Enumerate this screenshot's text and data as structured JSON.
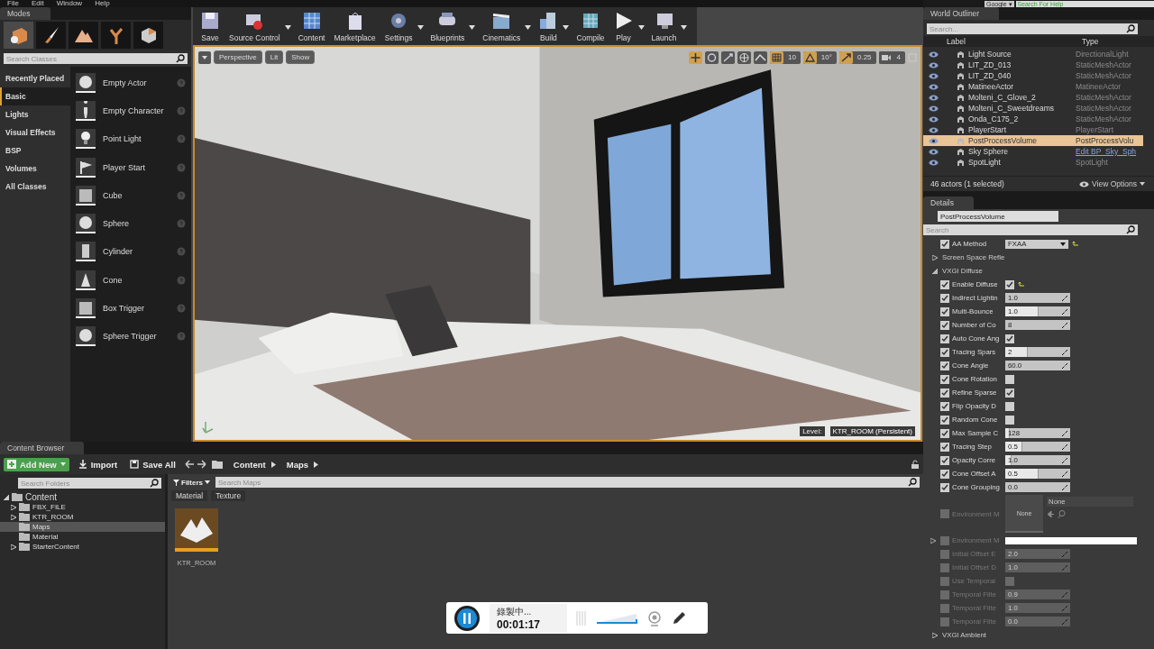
{
  "menu": [
    "File",
    "Edit",
    "Window",
    "Help"
  ],
  "help_search": {
    "scope": "Google ▾",
    "placeholder": "Search For Help"
  },
  "modes": {
    "tab": "Modes",
    "tools": [
      {
        "kind": "box",
        "selected": true
      },
      {
        "kind": "brush",
        "selected": false
      },
      {
        "kind": "mountain",
        "selected": false
      },
      {
        "kind": "leaf",
        "selected": false
      },
      {
        "kind": "cube",
        "selected": false
      }
    ],
    "search": {
      "placeholder": "Search Classes"
    },
    "categories": [
      {
        "label": "Recently Placed",
        "selected": false
      },
      {
        "label": "Basic",
        "selected": true
      },
      {
        "label": "Lights",
        "selected": false
      },
      {
        "label": "Visual Effects",
        "selected": false
      },
      {
        "label": "BSP",
        "selected": false
      },
      {
        "label": "Volumes",
        "selected": false
      },
      {
        "label": "All Classes",
        "selected": false
      }
    ],
    "items": [
      {
        "label": "Empty Actor",
        "kind": "sphere"
      },
      {
        "label": "Empty Character",
        "kind": "figure"
      },
      {
        "label": "Point Light",
        "kind": "bulb"
      },
      {
        "label": "Player Start",
        "kind": "flag"
      },
      {
        "label": "Cube",
        "kind": "cube"
      },
      {
        "label": "Sphere",
        "kind": "sphere"
      },
      {
        "label": "Cylinder",
        "kind": "cylinder"
      },
      {
        "label": "Cone",
        "kind": "cone"
      },
      {
        "label": "Box Trigger",
        "kind": "cube"
      },
      {
        "label": "Sphere Trigger",
        "kind": "sphere"
      }
    ]
  },
  "toolbar": [
    {
      "label": "Save",
      "kind": "disk",
      "dropdown": false
    },
    {
      "label": "Source Control",
      "kind": "database",
      "dropdown": true
    },
    {
      "label": "Content",
      "kind": "grid",
      "dropdown": false
    },
    {
      "label": "Marketplace",
      "kind": "bag",
      "dropdown": false
    },
    {
      "label": "Settings",
      "kind": "gear",
      "dropdown": true
    },
    {
      "label": "Blueprints",
      "kind": "gamepad",
      "dropdown": true
    },
    {
      "label": "Cinematics",
      "kind": "clapper",
      "dropdown": true
    },
    {
      "label": "Build",
      "kind": "cubes",
      "dropdown": true
    },
    {
      "label": "Compile",
      "kind": "cube",
      "dropdown": false
    },
    {
      "label": "Play",
      "kind": "play",
      "dropdown": true
    },
    {
      "label": "Launch",
      "kind": "monitor",
      "dropdown": true
    }
  ],
  "viewport": {
    "buttons": [
      "Perspective",
      "Lit",
      "Show"
    ],
    "tools": [
      {
        "kind": "move",
        "selected": true
      },
      {
        "kind": "rotate",
        "selected": false
      },
      {
        "kind": "scale",
        "selected": false
      },
      {
        "kind": "globe",
        "selected": false
      },
      {
        "kind": "surface",
        "selected": false
      }
    ],
    "snaps": [
      {
        "kind": "grid",
        "on": true,
        "value": "10"
      },
      {
        "kind": "angle",
        "on": true,
        "value": "10°"
      },
      {
        "kind": "scale",
        "on": true,
        "value": "0.25"
      },
      {
        "kind": "speed",
        "on": false,
        "value": "4"
      }
    ],
    "level_label": "Level:",
    "level_name": "KTR_ROOM (Persistent)"
  },
  "outliner": {
    "tab": "World Outliner",
    "search": {
      "placeholder": "Search..."
    },
    "columns": [
      "Label",
      "Type"
    ],
    "rows": [
      {
        "label": "Light Source",
        "type": "DirectionalLight",
        "kind": "plain",
        "selected": false
      },
      {
        "label": "LIT_ZD_013",
        "type": "StaticMeshActor",
        "kind": "plain",
        "selected": false
      },
      {
        "label": "LIT_ZD_040",
        "type": "StaticMeshActor",
        "kind": "plain",
        "selected": false
      },
      {
        "label": "MatineeActor",
        "type": "MatineeActor",
        "kind": "plain",
        "selected": false
      },
      {
        "label": "Molteni_C_Glove_2",
        "type": "StaticMeshActor",
        "kind": "plain",
        "selected": false
      },
      {
        "label": "Molteni_C_Sweetdreams",
        "type": "StaticMeshActor",
        "kind": "plain",
        "selected": false
      },
      {
        "label": "Onda_C175_2",
        "type": "StaticMeshActor",
        "kind": "plain",
        "selected": false
      },
      {
        "label": "PlayerStart",
        "type": "PlayerStart",
        "kind": "plain",
        "selected": false
      },
      {
        "label": "PostProcessVolume",
        "type": "PostProcessVolu",
        "kind": "plain",
        "selected": true
      },
      {
        "label": "Sky Sphere",
        "type": "Edit BP_Sky_Sph",
        "kind": "link",
        "selected": false
      },
      {
        "label": "SpotLight",
        "type": "SpotLight",
        "kind": "plain",
        "selected": false
      }
    ],
    "status": "46 actors (1 selected)",
    "view_options": "View Options"
  },
  "details": {
    "tab": "Details",
    "name": "PostProcessVolume",
    "search": {
      "placeholder": "Search"
    },
    "properties": [
      {
        "label": "AA Method",
        "kind": "dropdown",
        "enabled": true,
        "value": "FXAA",
        "reset": true
      },
      {
        "label": "Screen Space Refle",
        "kind": "group",
        "expanded": false
      },
      {
        "label": "VXGI Diffuse",
        "kind": "group",
        "expanded": true
      },
      {
        "label": "Enable Diffuse",
        "kind": "bool",
        "enabled": true,
        "checked": true,
        "reset": true
      },
      {
        "label": "Indirect Lightin",
        "kind": "number",
        "enabled": true,
        "value": "1.0"
      },
      {
        "label": "Multi-Bounce",
        "kind": "number",
        "enabled": true,
        "value": "1.0",
        "level": 0.5
      },
      {
        "label": "Number of Co",
        "kind": "number",
        "enabled": true,
        "value": "8"
      },
      {
        "label": "Auto Cone Ang",
        "kind": "bool",
        "enabled": true,
        "checked": true
      },
      {
        "label": "Tracing Spars",
        "kind": "number",
        "enabled": true,
        "value": "2",
        "level": 0.33
      },
      {
        "label": "Cone Angle",
        "kind": "number",
        "enabled": true,
        "value": "60.0"
      },
      {
        "label": "Cone Rotation",
        "kind": "bool",
        "enabled": true,
        "checked": false
      },
      {
        "label": "Refine Sparse",
        "kind": "bool",
        "enabled": true,
        "checked": true
      },
      {
        "label": "Flip Opacity D",
        "kind": "bool",
        "enabled": true,
        "checked": false
      },
      {
        "label": "Random Cone",
        "kind": "bool",
        "enabled": true,
        "checked": false
      },
      {
        "label": "Max Sample C",
        "kind": "number",
        "enabled": true,
        "value": "128",
        "level": 0.05
      },
      {
        "label": "Tracing Step",
        "kind": "number",
        "enabled": true,
        "value": "0.5",
        "level": 0.25
      },
      {
        "label": "Opacity Corre",
        "kind": "number",
        "enabled": true,
        "value": "1.0",
        "level": 0.08
      },
      {
        "label": "Cone Offset A",
        "kind": "number",
        "enabled": true,
        "value": "0.5",
        "level": 0.5
      },
      {
        "label": "Cone Grouping",
        "kind": "number",
        "enabled": true,
        "value": "0.0"
      },
      {
        "label": "Environment M",
        "kind": "texture",
        "enabled": false,
        "value": "None",
        "thumb": "None"
      },
      {
        "label": "Environment M",
        "kind": "color",
        "enabled": false,
        "expanded": false
      },
      {
        "label": "Initial Offset E",
        "kind": "number",
        "enabled": false,
        "value": "2.0"
      },
      {
        "label": "Initial Offset D",
        "kind": "number",
        "enabled": false,
        "value": "1.0"
      },
      {
        "label": "Use Temporal",
        "kind": "bool",
        "enabled": false,
        "checked": false
      },
      {
        "label": "Temporal Filte",
        "kind": "number",
        "enabled": false,
        "value": "0.9"
      },
      {
        "label": "Temporal Filte",
        "kind": "number",
        "enabled": false,
        "value": "1.0"
      },
      {
        "label": "Temporal Filte",
        "kind": "number",
        "enabled": false,
        "value": "0.0"
      },
      {
        "label": "VXGI Ambient",
        "kind": "group",
        "expanded": false
      }
    ]
  },
  "content_browser": {
    "tab": "Content Browser",
    "buttons": [
      {
        "label": "Add New",
        "kind": "add"
      },
      {
        "label": "Import",
        "kind": "import"
      },
      {
        "label": "Save All",
        "kind": "save"
      }
    ],
    "path": [
      "Content",
      "Maps"
    ],
    "folder_search": {
      "placeholder": "Search Folders"
    },
    "tree": [
      {
        "label": "Content",
        "expanded": true,
        "selected": false,
        "children": [
          {
            "label": "FBX_FILE",
            "expanded": false,
            "selected": false
          },
          {
            "label": "KTR_ROOM",
            "expanded": false,
            "selected": false
          },
          {
            "label": "Maps",
            "selected": true
          },
          {
            "label": "Material",
            "selected": false
          },
          {
            "label": "StarterContent",
            "expanded": false,
            "selected": false
          }
        ]
      }
    ],
    "filters": "Filters",
    "asset_search": {
      "placeholder": "Search Maps"
    },
    "filter_chips": [
      "Material",
      "Texture"
    ],
    "assets": [
      {
        "label": "KTR_ROOM"
      }
    ]
  },
  "recorder": {
    "status": "錄製中...",
    "time": "00:01:17"
  }
}
